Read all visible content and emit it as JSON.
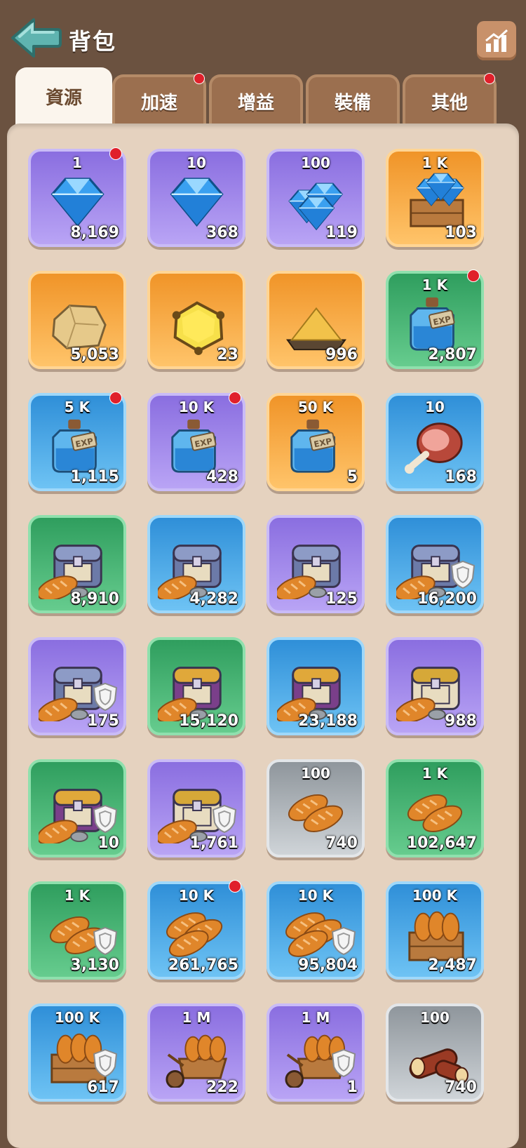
{
  "header": {
    "title": "背包"
  },
  "tabs": [
    {
      "label": "資源",
      "active": true,
      "badge": false
    },
    {
      "label": "加速",
      "active": false,
      "badge": true
    },
    {
      "label": "增益",
      "active": false,
      "badge": false
    },
    {
      "label": "裝備",
      "active": false,
      "badge": false
    },
    {
      "label": "其他",
      "active": false,
      "badge": true
    }
  ],
  "colors": {
    "accent_red": "#e0202b",
    "panel": "#e5d2bf",
    "frame": "#6b5240"
  },
  "items": [
    {
      "icon": "gem-icon",
      "bg": "purple",
      "denom": "1",
      "count": "8,169",
      "badge": true,
      "shield": false
    },
    {
      "icon": "gem-icon",
      "bg": "purple",
      "denom": "10",
      "count": "368",
      "badge": false,
      "shield": false
    },
    {
      "icon": "gem-pile-icon",
      "bg": "purple",
      "denom": "100",
      "count": "119",
      "badge": false,
      "shield": false
    },
    {
      "icon": "gem-crate-icon",
      "bg": "orange",
      "denom": "1 K",
      "count": "103",
      "badge": false,
      "shield": false
    },
    {
      "icon": "stone-icon",
      "bg": "orange",
      "denom": "",
      "count": "5,053",
      "badge": false,
      "shield": false
    },
    {
      "icon": "gold-ore-icon",
      "bg": "orange",
      "denom": "",
      "count": "23",
      "badge": false,
      "shield": false
    },
    {
      "icon": "gold-dust-icon",
      "bg": "orange",
      "denom": "",
      "count": "996",
      "badge": false,
      "shield": false
    },
    {
      "icon": "exp-potion-icon",
      "bg": "green",
      "denom": "1 K",
      "count": "2,807",
      "badge": true,
      "shield": false
    },
    {
      "icon": "exp-potion-icon",
      "bg": "blue",
      "denom": "5 K",
      "count": "1,115",
      "badge": true,
      "shield": false
    },
    {
      "icon": "exp-potion-icon",
      "bg": "purple",
      "denom": "10 K",
      "count": "428",
      "badge": true,
      "shield": false
    },
    {
      "icon": "exp-potion-icon",
      "bg": "orange",
      "denom": "50 K",
      "count": "5",
      "badge": false,
      "shield": false
    },
    {
      "icon": "ham-icon",
      "bg": "blue",
      "denom": "10",
      "count": "168",
      "badge": false,
      "shield": false
    },
    {
      "icon": "silver-chest-icon",
      "bg": "green",
      "denom": "",
      "count": "8,910",
      "badge": false,
      "shield": false
    },
    {
      "icon": "silver-chest-icon",
      "bg": "blue",
      "denom": "",
      "count": "4,282",
      "badge": false,
      "shield": false
    },
    {
      "icon": "silver-chest-icon",
      "bg": "purple",
      "denom": "",
      "count": "125",
      "badge": false,
      "shield": false
    },
    {
      "icon": "silver-chest-icon",
      "bg": "blue",
      "denom": "",
      "count": "16,200",
      "badge": false,
      "shield": true
    },
    {
      "icon": "silver-chest-icon",
      "bg": "purple",
      "denom": "",
      "count": "175",
      "badge": false,
      "shield": true
    },
    {
      "icon": "purple-chest-icon",
      "bg": "green",
      "denom": "",
      "count": "15,120",
      "badge": false,
      "shield": false
    },
    {
      "icon": "purple-chest-icon",
      "bg": "blue",
      "denom": "",
      "count": "23,188",
      "badge": false,
      "shield": false
    },
    {
      "icon": "gold-chest-icon",
      "bg": "purple",
      "denom": "",
      "count": "988",
      "badge": false,
      "shield": false
    },
    {
      "icon": "purple-chest-icon",
      "bg": "green",
      "denom": "",
      "count": "10",
      "badge": false,
      "shield": true
    },
    {
      "icon": "gold-chest-icon",
      "bg": "purple",
      "denom": "",
      "count": "1,761",
      "badge": false,
      "shield": true
    },
    {
      "icon": "bread-icon",
      "bg": "gray",
      "denom": "100",
      "count": "740",
      "badge": false,
      "shield": false
    },
    {
      "icon": "bread-icon",
      "bg": "green",
      "denom": "1 K",
      "count": "102,647",
      "badge": false,
      "shield": false
    },
    {
      "icon": "bread-icon",
      "bg": "green",
      "denom": "1 K",
      "count": "3,130",
      "badge": false,
      "shield": true
    },
    {
      "icon": "bread-stack-icon",
      "bg": "blue",
      "denom": "10 K",
      "count": "261,765",
      "badge": true,
      "shield": false
    },
    {
      "icon": "bread-stack-icon",
      "bg": "blue",
      "denom": "10 K",
      "count": "95,804",
      "badge": false,
      "shield": true
    },
    {
      "icon": "bread-crate-icon",
      "bg": "blue",
      "denom": "100 K",
      "count": "2,487",
      "badge": false,
      "shield": false
    },
    {
      "icon": "bread-crate-icon",
      "bg": "blue",
      "denom": "100 K",
      "count": "617",
      "badge": false,
      "shield": true
    },
    {
      "icon": "bread-cart-icon",
      "bg": "purple",
      "denom": "1 M",
      "count": "222",
      "badge": false,
      "shield": false
    },
    {
      "icon": "bread-cart-icon",
      "bg": "purple",
      "denom": "1 M",
      "count": "1",
      "badge": false,
      "shield": true
    },
    {
      "icon": "wood-log-icon",
      "bg": "gray",
      "denom": "100",
      "count": "740",
      "badge": false,
      "shield": false
    }
  ]
}
